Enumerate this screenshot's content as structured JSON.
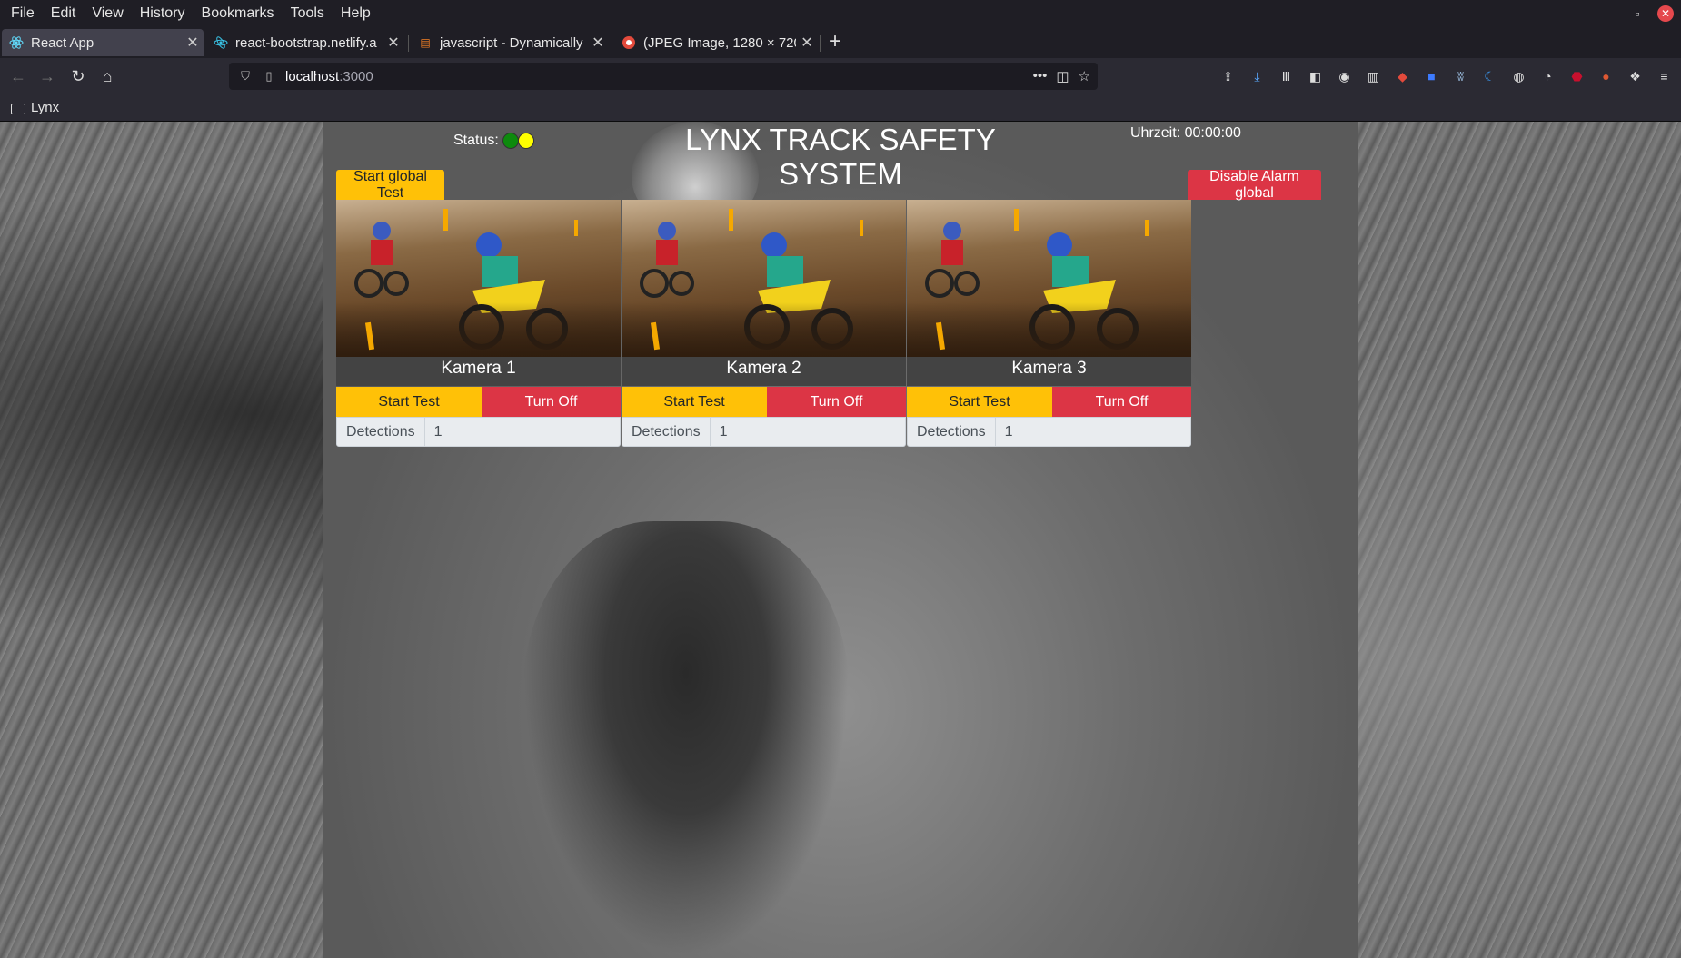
{
  "browser": {
    "menu": [
      "File",
      "Edit",
      "View",
      "History",
      "Bookmarks",
      "Tools",
      "Help"
    ],
    "tabs": [
      {
        "label": "React App",
        "icon": "react-icon",
        "active": true
      },
      {
        "label": "react-bootstrap.netlify.a",
        "icon": "bootstrap-icon",
        "active": false
      },
      {
        "label": "javascript - Dynamically a",
        "icon": "stackoverflow-icon",
        "active": false
      },
      {
        "label": "(JPEG Image, 1280 × 720",
        "icon": "image-icon",
        "active": false
      }
    ],
    "url": {
      "host": "localhost",
      "port": ":3000"
    },
    "bookmarks": [
      "Lynx"
    ]
  },
  "app": {
    "title": "LYNX TRACK SAFETY SYSTEM",
    "status_label": "Status:",
    "status_lights": [
      "green",
      "yellow"
    ],
    "clock": "Uhrzeit: 00:00:00",
    "global_test_label": "Start global Test",
    "disable_alarm_label": "Disable Alarm global",
    "cameras": [
      {
        "name": "Kamera 1",
        "start_label": "Start Test",
        "off_label": "Turn Off",
        "detections_label": "Detections",
        "detections_value": "1"
      },
      {
        "name": "Kamera 2",
        "start_label": "Start Test",
        "off_label": "Turn Off",
        "detections_label": "Detections",
        "detections_value": "1"
      },
      {
        "name": "Kamera 3",
        "start_label": "Start Test",
        "off_label": "Turn Off",
        "detections_label": "Detections",
        "detections_value": "1"
      }
    ]
  },
  "colors": {
    "warning": "#ffc107",
    "danger": "#dc3545",
    "status_green": "#0d8a0d",
    "status_yellow": "#ffff00"
  }
}
